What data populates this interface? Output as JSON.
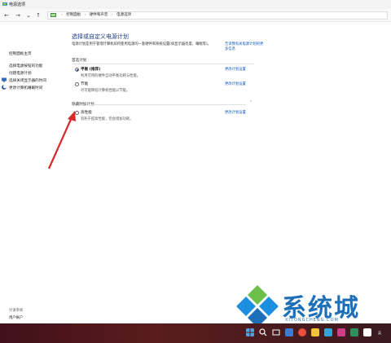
{
  "window": {
    "title": "电源选项"
  },
  "nav": {
    "back": "←",
    "forward": "→",
    "down": "⌄",
    "up": "↑",
    "crumbs": [
      "控制面板",
      "硬件和声音",
      "电源选项"
    ],
    "separator": "›"
  },
  "sidebar": {
    "home": "控制面板主页",
    "links": [
      "选择电源按钮的功能",
      "创建电源计划",
      "选择关闭显示器的时间",
      "更改计算机睡眠时间"
    ],
    "see_also": "另请参阅",
    "user_accounts": "用户帐户"
  },
  "main": {
    "heading": "选择或自定义电源计划",
    "description": "电源计划是用于管理计算机如何使用电源的一套硬件和系统设置(如显示器亮度、睡眠等)。",
    "tell_more_link": "告诉我有关电源计划的更多信息",
    "preferred_title": "首选计划",
    "plans": [
      {
        "name": "平衡 (推荐)",
        "desc": "利用可用的硬件自动平衡功耗与性能。",
        "link": "更改计划设置",
        "selected": true
      },
      {
        "name": "节能",
        "desc": "尽可能降低计算机性能以节能。",
        "link": "更改计划设置",
        "selected": false
      }
    ],
    "hidden_title": "隐藏附加计划",
    "hidden_plans": [
      {
        "name": "高性能",
        "desc": "有利于提高性能，但会增加功耗。",
        "link": "更改计划设置",
        "selected": false
      }
    ]
  },
  "watermark": {
    "text": "系统城",
    "sub": "XITONGCHENG.COM"
  },
  "taskbar": {
    "tray_text": "英"
  },
  "colors": {
    "accent": "#1f3c88",
    "link": "#0a57c2",
    "arrow": "#d62b2b",
    "taskbar": "#4a1519"
  }
}
